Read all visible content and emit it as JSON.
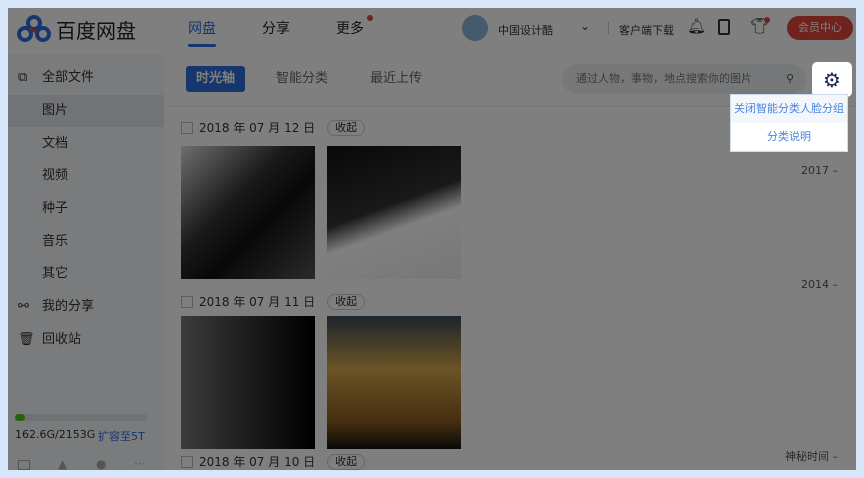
{
  "header": {
    "logo_text": "百度网盘",
    "nav": [
      {
        "label": "网盘",
        "active": true
      },
      {
        "label": "分享"
      },
      {
        "label": "更多",
        "badge": true
      }
    ],
    "username": "中国设计酷",
    "download": "客户端下载",
    "vip_button": "会员中心"
  },
  "sidebar": {
    "items": [
      {
        "label": "全部文件",
        "icon": "files-icon"
      },
      {
        "label": "图片",
        "selected": true
      },
      {
        "label": "文档"
      },
      {
        "label": "视频"
      },
      {
        "label": "种子"
      },
      {
        "label": "音乐"
      },
      {
        "label": "其它"
      },
      {
        "label": "我的分享",
        "icon": "share-icon"
      },
      {
        "label": "回收站",
        "icon": "trash-icon"
      }
    ],
    "storage": {
      "used": "162.6G/2153G",
      "used_fraction": 0.075,
      "expand": "扩容至5T"
    }
  },
  "main": {
    "tabs": [
      "时光轴",
      "智能分类",
      "最近上传"
    ],
    "search_placeholder": "通过人物，事物，地点搜索你的图片",
    "groups": [
      {
        "date": "2018 年 07 月 12 日",
        "fold": "收起"
      },
      {
        "date": "2018 年 07 月 11 日",
        "fold": "收起"
      },
      {
        "date": "2018 年 07 月 10 日",
        "fold": "收起"
      }
    ],
    "timeline": [
      "2017 –",
      "2014 –",
      "神秘时间 –"
    ]
  },
  "settings_menu": {
    "items": [
      "关闭智能分类人脸分组",
      "分类说明"
    ]
  },
  "colors": {
    "accent": "#2a6fdc",
    "vip": "#e0443a",
    "storage_bar": "#52c41a"
  }
}
